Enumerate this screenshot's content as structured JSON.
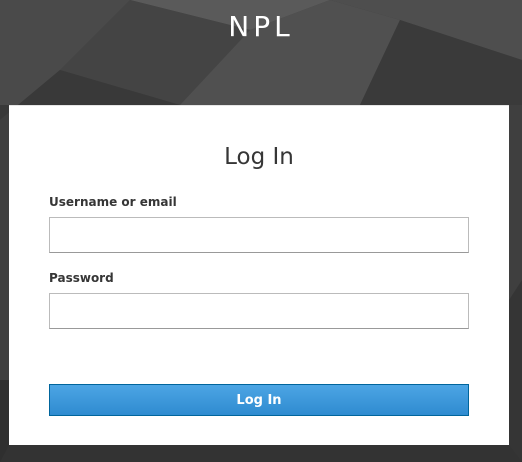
{
  "brand": {
    "title": "NPL"
  },
  "login_card": {
    "title": "Log In",
    "username_label": "Username or email",
    "username_value": "",
    "password_label": "Password",
    "password_value": "",
    "submit_label": "Log In"
  },
  "colors": {
    "background": "#3c3c3c",
    "card": "#ffffff",
    "button_top": "#4ca5e4",
    "button_bottom": "#2f8bd0",
    "button_border": "#00659c",
    "text": "#363636"
  }
}
